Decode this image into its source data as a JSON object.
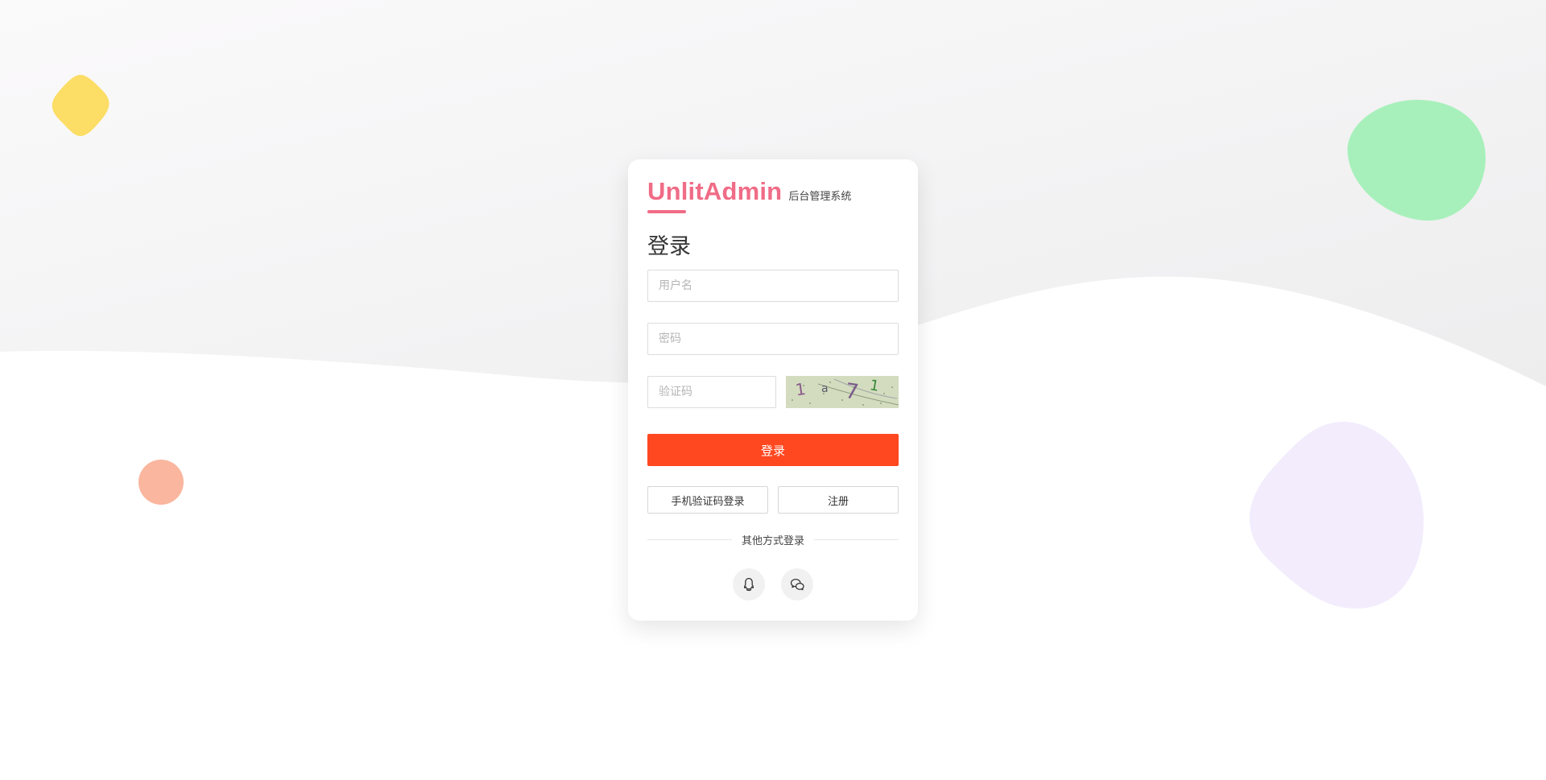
{
  "brand": {
    "name": "UnlitAdmin",
    "subtitle": "后台管理系统",
    "accent_color": "#f06c86"
  },
  "login": {
    "title": "登录",
    "username_placeholder": "用户名",
    "password_placeholder": "密码",
    "captcha_placeholder": "验证码",
    "captcha_image_text": "1 a 7 1",
    "submit_label": "登录",
    "submit_color": "#ff4720",
    "sms_login_label": "手机验证码登录",
    "register_label": "注册",
    "other_methods_label": "其他方式登录"
  },
  "social": [
    {
      "name": "qq",
      "icon": "qq-penguin-icon"
    },
    {
      "name": "wechat",
      "icon": "wechat-icon"
    }
  ],
  "decorations": {
    "colors": [
      "#fcdd65",
      "#a8f0bb",
      "#fab69e",
      "#f2ecfd"
    ]
  }
}
